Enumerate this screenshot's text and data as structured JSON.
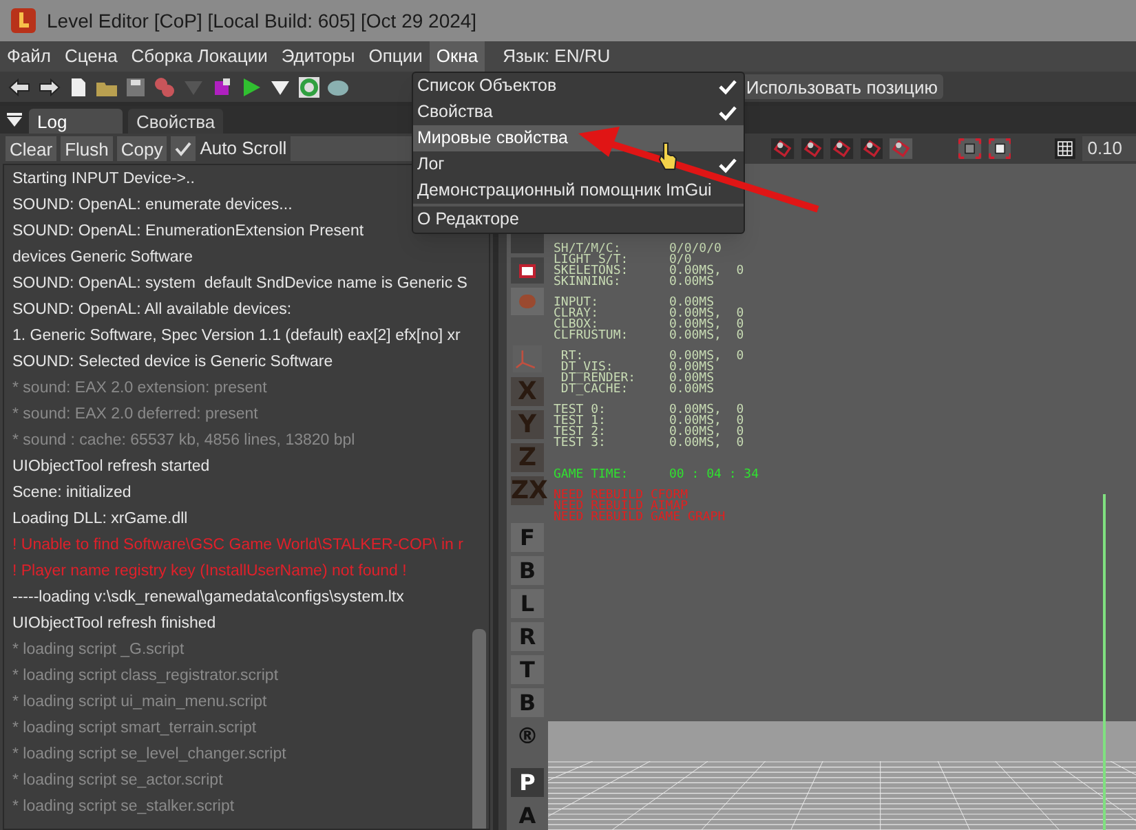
{
  "window": {
    "title": "Level Editor [CoP] [Local Build: 605] [Oct 29 2024]"
  },
  "menu": [
    {
      "label": "Файл",
      "selected": false
    },
    {
      "label": "Сцена",
      "selected": false
    },
    {
      "label": "Сборка Локации",
      "selected": false
    },
    {
      "label": "Эдиторы",
      "selected": false
    },
    {
      "label": "Опции",
      "selected": false
    },
    {
      "label": "Окна",
      "selected": true
    },
    {
      "label": "Язык: EN/RU",
      "selected": false
    }
  ],
  "dropdown": [
    {
      "label": "Список Объектов",
      "checked": true,
      "selected": false
    },
    {
      "label": "Свойства",
      "checked": true,
      "selected": false
    },
    {
      "label": "Мировые свойства",
      "checked": false,
      "selected": true
    },
    {
      "label": "Лог",
      "checked": true,
      "selected": false
    },
    {
      "label": "Демонстрационный помощник ImGui",
      "checked": false,
      "selected": false
    },
    {
      "label": "О Редакторе",
      "checked": false,
      "selected": false,
      "separator_before": true
    }
  ],
  "toolbar": {
    "use_position_button": "Использовать позицию"
  },
  "tabs": [
    {
      "label": "Log",
      "selected": true
    },
    {
      "label": "Свойства",
      "selected": false
    }
  ],
  "log_toolbar": {
    "buttons": [
      "Clear",
      "Flush",
      "Copy"
    ],
    "auto_scroll": {
      "label": "Auto Scroll",
      "checked": true
    }
  },
  "log": [
    {
      "text": "Starting INPUT Device->..",
      "kind": "info"
    },
    {
      "text": "SOUND: OpenAL: enumerate devices...",
      "kind": "info"
    },
    {
      "text": "SOUND: OpenAL: EnumerationExtension Present",
      "kind": "info"
    },
    {
      "text": "devices Generic Software",
      "kind": "info"
    },
    {
      "text": "SOUND: OpenAL: system  default SndDevice name is Generic S",
      "kind": "info"
    },
    {
      "text": "SOUND: OpenAL: All available devices:",
      "kind": "info"
    },
    {
      "text": "1. Generic Software, Spec Version 1.1 (default) eax[2] efx[no] xr",
      "kind": "info"
    },
    {
      "text": "SOUND: Selected device is Generic Software",
      "kind": "info"
    },
    {
      "text": "* sound: EAX 2.0 extension: present",
      "kind": "dim"
    },
    {
      "text": "* sound: EAX 2.0 deferred: present",
      "kind": "dim"
    },
    {
      "text": "* sound : cache: 65537 kb, 4856 lines, 13820 bpl",
      "kind": "dim"
    },
    {
      "text": "UIObjectTool refresh started",
      "kind": "info"
    },
    {
      "text": "Scene: initialized",
      "kind": "info"
    },
    {
      "text": "Loading DLL: xrGame.dll",
      "kind": "info"
    },
    {
      "text": "! Unable to find Software\\GSC Game World\\STALKER-COP\\ in r",
      "kind": "error"
    },
    {
      "text": "! Player name registry key (InstallUserName) not found !",
      "kind": "error"
    },
    {
      "text": "-----loading v:\\sdk_renewal\\gamedata\\configs\\system.ltx",
      "kind": "info"
    },
    {
      "text": "UIObjectTool refresh finished",
      "kind": "info"
    },
    {
      "text": "* loading script _G.script",
      "kind": "dim"
    },
    {
      "text": "* loading script class_registrator.script",
      "kind": "dim"
    },
    {
      "text": "* loading script ui_main_menu.script",
      "kind": "dim"
    },
    {
      "text": "* loading script smart_terrain.script",
      "kind": "dim"
    },
    {
      "text": "* loading script se_level_changer.script",
      "kind": "dim"
    },
    {
      "text": "* loading script se_actor.script",
      "kind": "dim"
    },
    {
      "text": "* loading script se_stalker.script",
      "kind": "dim"
    }
  ],
  "viewport": {
    "grid_step": "0.10",
    "stats": [
      [
        {
          "label": "SH/T/M/C:",
          "value": "0/0/0/0"
        },
        {
          "label": "LIGHT S/T:",
          "value": "0/0"
        },
        {
          "label": "SKELETONS:",
          "value": "0.00MS,  0"
        },
        {
          "label": "SKINNING:",
          "value": "0.00MS"
        }
      ],
      [
        {
          "label": "INPUT:",
          "value": "0.00MS"
        },
        {
          "label": "CLRAY:",
          "value": "0.00MS,  0"
        },
        {
          "label": "CLBOX:",
          "value": "0.00MS,  0"
        },
        {
          "label": "CLFRUSTUM:",
          "value": "0.00MS,  0"
        }
      ],
      [
        {
          "label": " RT:",
          "value": "0.00MS,  0"
        },
        {
          "label": " DT_VIS:",
          "value": "0.00MS"
        },
        {
          "label": " DT_RENDER:",
          "value": "0.00MS"
        },
        {
          "label": " DT_CACHE:",
          "value": "0.00MS"
        }
      ],
      [
        {
          "label": "TEST 0:",
          "value": "0.00MS,  0"
        },
        {
          "label": "TEST 1:",
          "value": "0.00MS,  0"
        },
        {
          "label": "TEST 2:",
          "value": "0.00MS,  0"
        },
        {
          "label": "TEST 3:",
          "value": "0.00MS,  0"
        }
      ]
    ],
    "game_time": {
      "label": "GAME TIME:",
      "value": "00 : 04 : 34"
    },
    "warnings": [
      "NEED REBUILD CFORM",
      "NEED REBUILD AIMAP",
      "NEED REBUILD GAME GRAPH"
    ],
    "view_buttons": [
      {
        "label": "X",
        "kind": "axis"
      },
      {
        "label": "Y",
        "kind": "axis"
      },
      {
        "label": "Z",
        "kind": "axis"
      },
      {
        "label": "ZX",
        "kind": "axis"
      },
      {
        "label": "F",
        "kind": "view"
      },
      {
        "label": "B",
        "kind": "view"
      },
      {
        "label": "L",
        "kind": "view"
      },
      {
        "label": "R",
        "kind": "view"
      },
      {
        "label": "T",
        "kind": "view"
      },
      {
        "label": "B",
        "kind": "view"
      },
      {
        "label": "®",
        "kind": "plain"
      },
      {
        "label": "P",
        "kind": "dark"
      },
      {
        "label": "A",
        "kind": "plain"
      }
    ]
  }
}
